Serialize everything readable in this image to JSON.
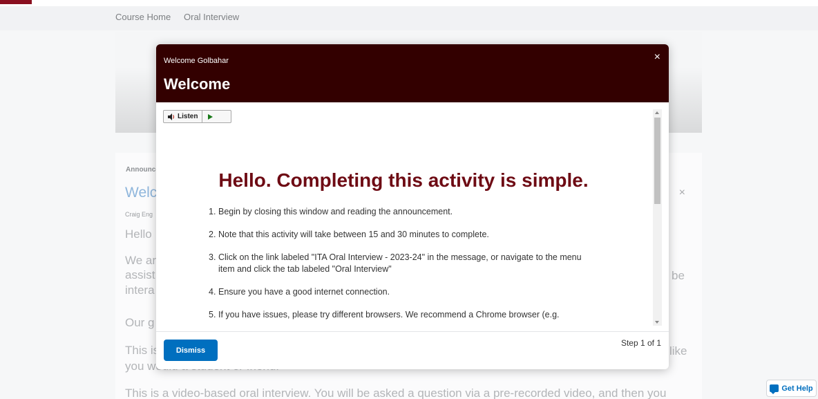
{
  "nav": {
    "course_home": "Course Home",
    "oral_interview": "Oral Interview"
  },
  "announcement": {
    "label": "Announcements",
    "title": "Welcome",
    "author": "Craig Eng",
    "close": "×",
    "paragraphs": [
      "Hello",
      "We ar",
      "assist",
      "intera",
      "Our g",
      "This is",
      "you would a student or friend."
    ],
    "right_fragments": [
      "be",
      "like"
    ],
    "bottom_line": "This is a video-based oral interview. You will be asked a question via a pre-recorded video, and then you"
  },
  "modal": {
    "subtitle": "Welcome Golbahar",
    "title": "Welcome",
    "close": "×",
    "listen_label": "Listen",
    "listen_icon": "speaker-icon",
    "play_icon": "play-icon",
    "heading": "Hello. Completing this activity is simple.",
    "steps": [
      {
        "num": "1.",
        "text": "Begin by closing this window and reading the announcement."
      },
      {
        "num": "2.",
        "text": "Note that this activity will take between 15 and 30 minutes to complete."
      },
      {
        "num": "3.",
        "text": "Click on the link labeled \"ITA Oral Interview - 2023-24\" in the message, or navigate to the menu item and click the tab labeled \"Oral Interview\""
      },
      {
        "num": "4.",
        "text": "Ensure you have a good internet connection."
      },
      {
        "num": "5.",
        "text": "If you have issues, please try different browsers. We recommend a Chrome browser (e.g."
      }
    ],
    "dismiss_label": "Dismiss",
    "step_count": "Step 1 of 1"
  },
  "help": {
    "label": "Get Help",
    "icon": "chat-icon"
  },
  "colors": {
    "header_bg": "#330000",
    "heading": "#6e0b14",
    "primary": "#006fbf"
  }
}
